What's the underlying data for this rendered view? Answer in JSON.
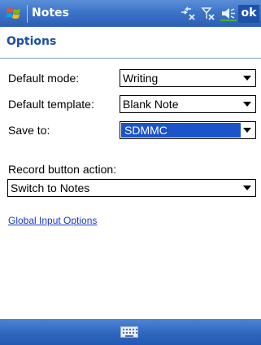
{
  "titlebar": {
    "app_title": "Notes",
    "ok_label": "ok"
  },
  "page": {
    "heading": "Options"
  },
  "form": {
    "default_mode": {
      "label": "Default mode:",
      "value": "Writing"
    },
    "default_template": {
      "label": "Default template:",
      "value": "Blank Note"
    },
    "save_to": {
      "label": "Save to:",
      "value": "SDMMC"
    },
    "record_button_action": {
      "label": "Record button action:",
      "value": "Switch to Notes"
    }
  },
  "links": {
    "global_input_options": "Global Input Options"
  },
  "icons": {
    "start": "windows-flag-icon",
    "status": [
      "connectivity-icon",
      "signal-off-icon",
      "volume-icon"
    ],
    "menubar": "keyboard-icon"
  },
  "colors": {
    "titlebar": "#3d74c8",
    "heading": "#1b4fa1",
    "selection": "#1b54c9",
    "link": "#1a38c4"
  }
}
